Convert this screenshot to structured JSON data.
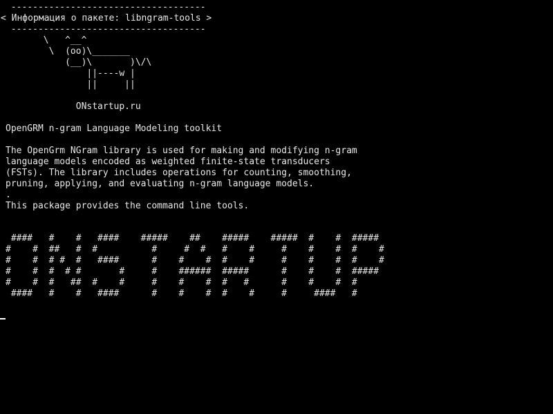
{
  "terminal": {
    "bubble": {
      "top_border": " ------------------------------------",
      "title_line": "< Информация о пакете: libngram-tools >",
      "bottom_border": " ------------------------------------"
    },
    "cow": [
      "       \\   ^__^",
      "        \\  (oo)\\_______",
      "           (__)\\       )\\/\\",
      "               ||----w |",
      "               ||     ||"
    ],
    "site": "             ONstartup.ru",
    "package_summary": "OpenGRM n-gram Language Modeling toolkit",
    "description": [
      "The OpenGrm NGram library is used for making and modifying n-gram",
      "language models encoded as weighted finite-state transducers",
      "(FSTs). The library includes operations for counting, smoothing,",
      "pruning, applying, and evaluating n-gram language models.",
      ".",
      "This package provides the command line tools."
    ],
    "banner": [
      " ####   #    #   ####    #####    ##    #####    #####  #    #  #####",
      "#    #  ##   #  #          #     #  #   #    #     #    #    #  #    #",
      "#    #  # #  #   ####      #    #    #  #    #     #    #    #  #    #",
      "#    #  #  # #       #     #    ######  #####      #    #    #  #####",
      "#    #  #   ##  #    #     #    #    #  #   #      #    #    #  #",
      " ####   #    #   ####      #    #    #  #    #     #     ####   #"
    ],
    "text_color": "#e8e8e8",
    "background_color": "#000000"
  }
}
